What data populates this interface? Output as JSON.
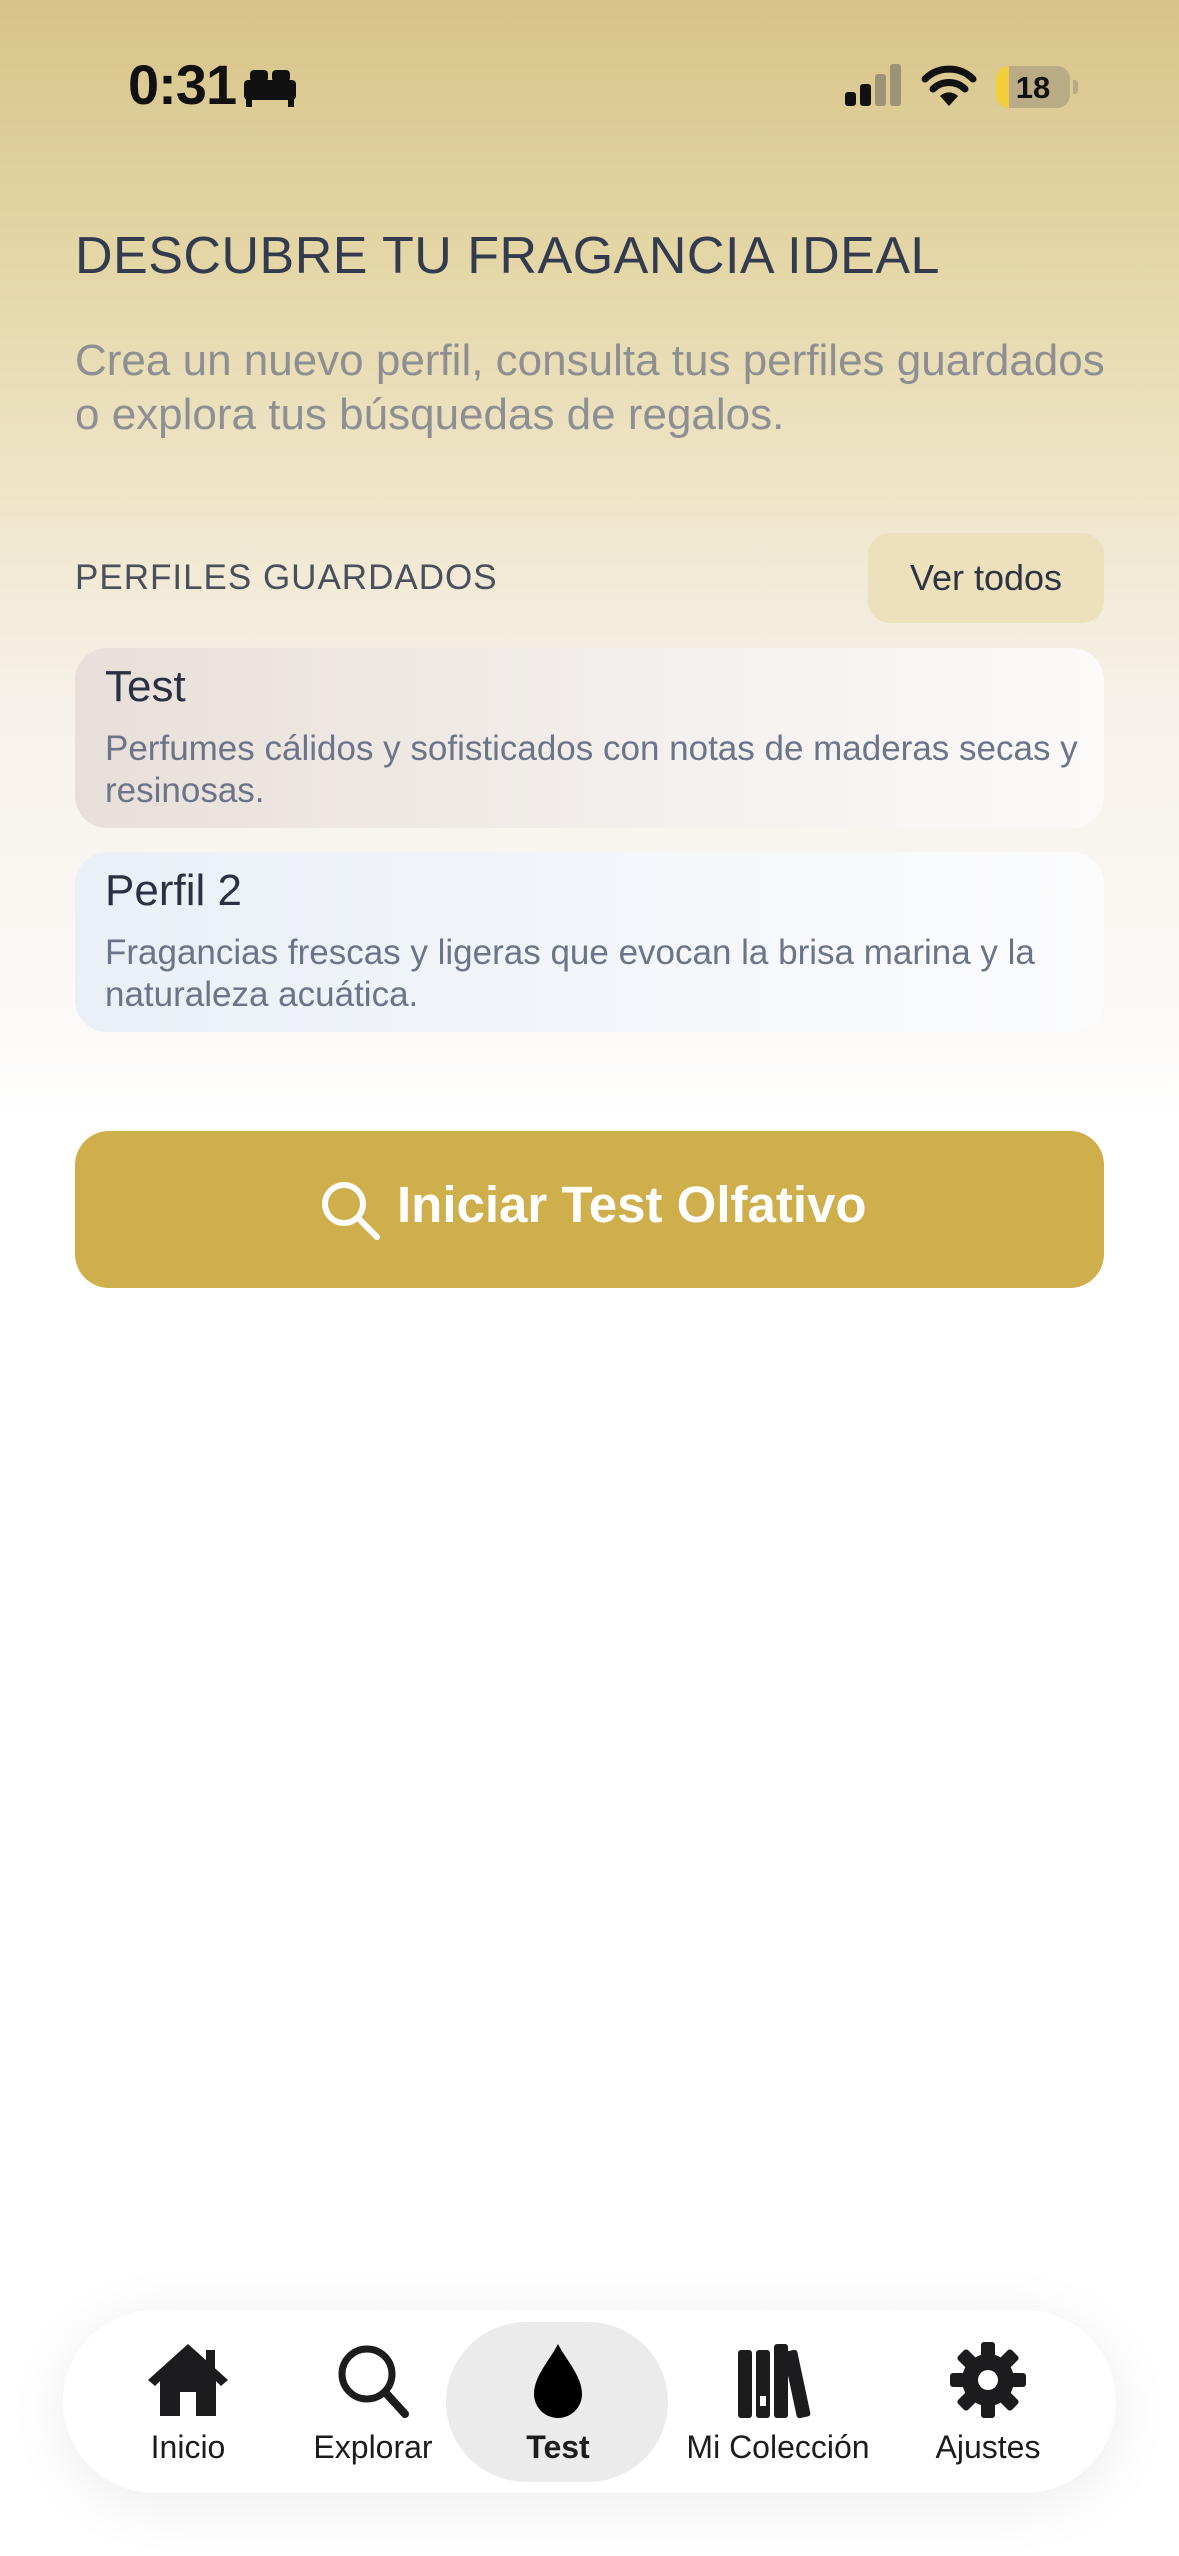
{
  "status_bar": {
    "time": "0:31",
    "battery": "18",
    "battery_level_percent": 18
  },
  "header": {
    "title": "DESCUBRE TU FRAGANCIA IDEAL",
    "subtitle": "Crea un nuevo perfil, consulta tus perfiles guardados o explora tus búsquedas de regalos."
  },
  "saved_profiles": {
    "label": "PERFILES GUARDADOS",
    "see_all": "Ver todos",
    "items": [
      {
        "name": "Test",
        "description": "Perfumes cálidos y sofisticados con notas de maderas secas y resinosas."
      },
      {
        "name": "Perfil 2",
        "description": "Fragancias frescas y ligeras que evocan la brisa marina y la naturaleza acuática."
      }
    ]
  },
  "primary_action": {
    "label": "Iniciar Test Olfativo",
    "icon": "search-icon",
    "color": "#ceaf4b"
  },
  "tab_bar": {
    "active": "Test",
    "tabs": [
      {
        "label": "Inicio",
        "icon": "house-icon"
      },
      {
        "label": "Explorar",
        "icon": "search-icon"
      },
      {
        "label": "Test",
        "icon": "drop-icon"
      },
      {
        "label": "Mi Colección",
        "icon": "books-icon"
      },
      {
        "label": "Ajustes",
        "icon": "gear-icon"
      }
    ]
  }
}
